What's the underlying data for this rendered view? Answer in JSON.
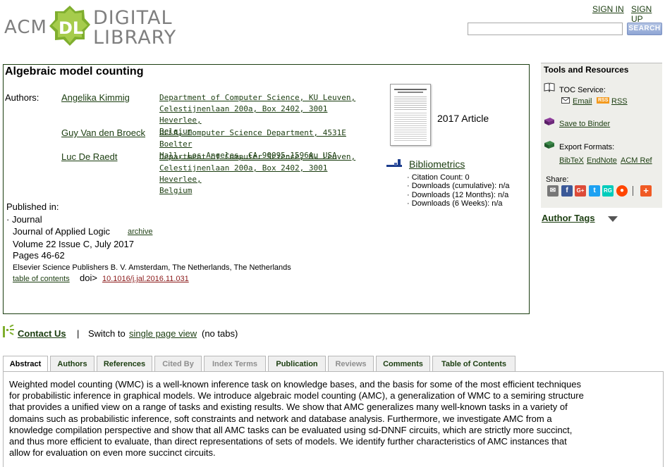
{
  "header": {
    "logo_acm": "ACM",
    "logo_dl": "DL",
    "logo_digital": "DIGITAL",
    "logo_library": "LIBRARY",
    "signin": "SIGN IN",
    "signup": "SIGN UP",
    "search_placeholder": "",
    "search_button": "SEARCH"
  },
  "article": {
    "title": "Algebraic model counting",
    "authors_label": "Authors:",
    "authors": [
      {
        "name": "Angelika Kimmig",
        "affil": [
          "Department of Computer Science, KU Leuven,",
          "Celestijnenlaan 200a, Box 2402, 3001 Heverlee,",
          "Belgium"
        ]
      },
      {
        "name": "Guy Van den Broeck",
        "affil": [
          "UCLA, Computer Science Department, 4531E Boelter",
          "Hall, Los Angeles, CA 90095-1596A, USA"
        ]
      },
      {
        "name": "Luc De Raedt",
        "affil": [
          "Department of Computer Science, KU Leuven,",
          "Celestijnenlaan 200a, Box 2402, 3001 Heverlee,",
          "Belgium"
        ]
      }
    ],
    "year_type": "2017 Article",
    "bibliometrics": {
      "title": "Bibliometrics",
      "citation_count": "· Citation Count: 0",
      "dl_cumulative": "· Downloads (cumulative): n/a",
      "dl_12": "· Downloads (12 Months): n/a",
      "dl_6": "· Downloads (6 Weeks): n/a"
    },
    "published": {
      "label": "Published in:",
      "type": "· Journal",
      "journal": "Journal of Applied Logic",
      "archive": "archive",
      "volume": "Volume 22 Issue C, July 2017",
      "pages": "Pages 46-62",
      "publisher": "Elsevier Science Publishers B. V.  Amsterdam, The Netherlands, The Netherlands",
      "toc": "table of contents",
      "doi_label": "doi>",
      "doi": "10.1016/j.jal.2016.11.031"
    }
  },
  "side": {
    "title": "Tools and Resources",
    "toc_service": "TOC Service:",
    "email": "Email",
    "rss_badge": "RSS",
    "rss": "RSS",
    "save_binder": "Save to Binder",
    "export_formats": "Export Formats:",
    "bibtex": "BibTeX",
    "endnote": "EndNote",
    "acmref": "ACM Ref",
    "share": "Share:",
    "author_tags": "Author Tags"
  },
  "contact": {
    "contact_us": "Contact Us",
    "separator": "|",
    "switch_to": "Switch to",
    "single_page": "single page view",
    "no_tabs": "(no tabs)"
  },
  "tabs": [
    "Abstract",
    "Authors",
    "References",
    "Cited By",
    "Index Terms",
    "Publication",
    "Reviews",
    "Comments",
    "Table of Contents"
  ],
  "abstract_lines": [
    "Weighted model counting (WMC) is a well-known inference task on knowledge bases, and the basis for some of the most efficient techniques",
    "for probabilistic inference in graphical models. We introduce algebraic model counting (AMC), a generalization of WMC to a semiring structure",
    "that provides a unified view on a range of tasks and existing results. We show that AMC generalizes many well-known tasks in a variety of",
    "domains such as probabilistic inference, soft constraints and network and database analysis. Furthermore, we investigate AMC from a",
    "knowledge compilation perspective and show that all AMC tasks can be evaluated using sd-DNNF circuits, which are strictly more succinct,",
    "and thus more efficient to evaluate, than direct representations of sets of models. We identify further characteristics of AMC instances that",
    "allow for evaluation on even more succinct circuits."
  ],
  "colors": {
    "link": "#1b3d10",
    "doi": "#8b1a1a",
    "logo_green": "#7fae2e"
  }
}
